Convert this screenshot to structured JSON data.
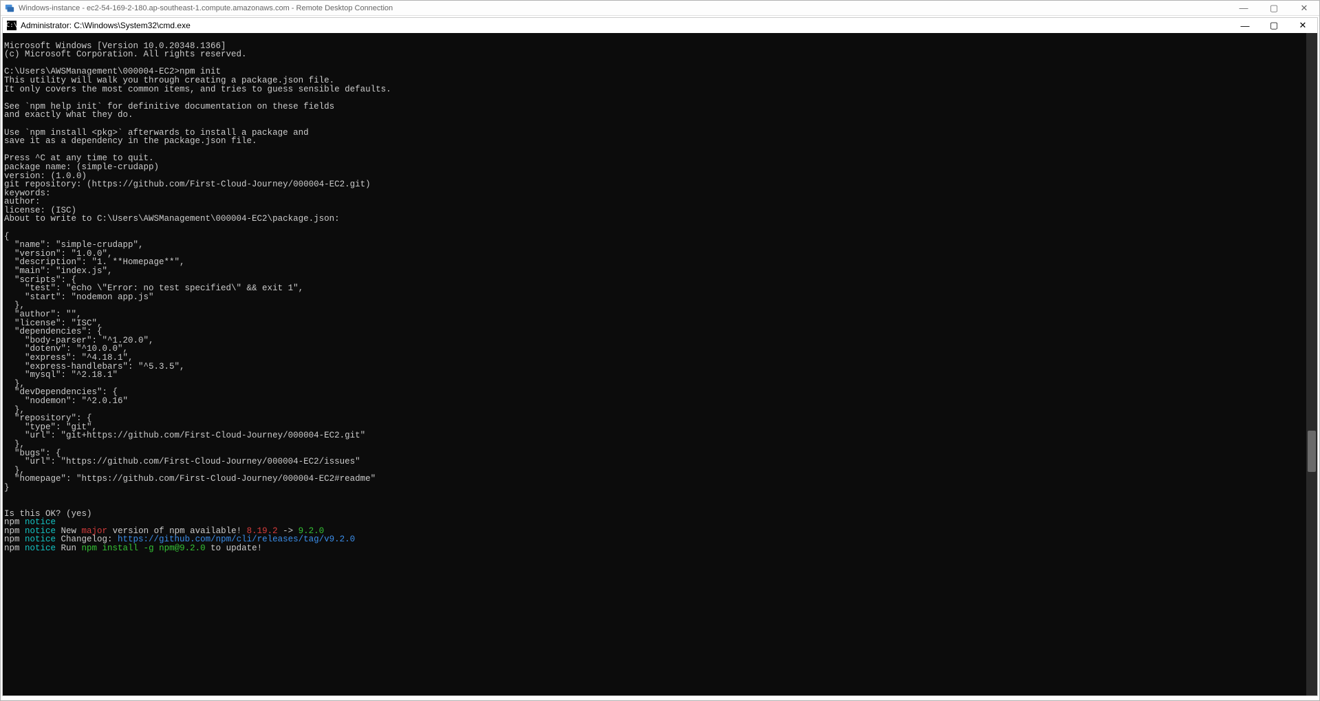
{
  "rdp": {
    "title": "Windows-instance - ec2-54-169-2-180.ap-southeast-1.compute.amazonaws.com - Remote Desktop Connection"
  },
  "cmd": {
    "title": "Administrator: C:\\Windows\\System32\\cmd.exe"
  },
  "terminal": {
    "header1": "Microsoft Windows [Version 10.0.20348.1366]",
    "header2": "(c) Microsoft Corporation. All rights reserved.",
    "prompt_cmd": "C:\\Users\\AWSManagement\\000004-EC2>npm init",
    "init1": "This utility will walk you through creating a package.json file.",
    "init2": "It only covers the most common items, and tries to guess sensible defaults.",
    "init3": "See `npm help init` for definitive documentation on these fields",
    "init4": "and exactly what they do.",
    "init5": "Use `npm install <pkg>` afterwards to install a package and",
    "init6": "save it as a dependency in the package.json file.",
    "init7": "Press ^C at any time to quit.",
    "q_pkg": "package name: (simple-crudapp)",
    "q_ver": "version: (1.0.0)",
    "q_git": "git repository: (https://github.com/First-Cloud-Journey/000004-EC2.git)",
    "q_keywords": "keywords:",
    "q_author": "author:",
    "q_license": "license: (ISC)",
    "about": "About to write to C:\\Users\\AWSManagement\\000004-EC2\\package.json:",
    "pkgjson": {
      "l00": "{",
      "l01": "  \"name\": \"simple-crudapp\",",
      "l02": "  \"version\": \"1.0.0\",",
      "l03": "  \"description\": \"1. **Homepage**\",",
      "l04": "  \"main\": \"index.js\",",
      "l05": "  \"scripts\": {",
      "l06": "    \"test\": \"echo \\\"Error: no test specified\\\" && exit 1\",",
      "l07": "    \"start\": \"nodemon app.js\"",
      "l08": "  },",
      "l09": "  \"author\": \"\",",
      "l10": "  \"license\": \"ISC\",",
      "l11": "  \"dependencies\": {",
      "l12": "    \"body-parser\": \"^1.20.0\",",
      "l13": "    \"dotenv\": \"^10.0.0\",",
      "l14": "    \"express\": \"^4.18.1\",",
      "l15": "    \"express-handlebars\": \"^5.3.5\",",
      "l16": "    \"mysql\": \"^2.18.1\"",
      "l17": "  },",
      "l18": "  \"devDependencies\": {",
      "l19": "    \"nodemon\": \"^2.0.16\"",
      "l20": "  },",
      "l21": "  \"repository\": {",
      "l22": "    \"type\": \"git\",",
      "l23": "    \"url\": \"git+https://github.com/First-Cloud-Journey/000004-EC2.git\"",
      "l24": "  },",
      "l25": "  \"bugs\": {",
      "l26": "    \"url\": \"https://github.com/First-Cloud-Journey/000004-EC2/issues\"",
      "l27": "  },",
      "l28": "  \"homepage\": \"https://github.com/First-Cloud-Journey/000004-EC2#readme\"",
      "l29": "}"
    },
    "isok": "Is this OK? (yes)",
    "npm_prefix": "npm ",
    "notice": "notice",
    "notice2a": " New ",
    "major": "major",
    "notice2b": " version of npm available! ",
    "old_ver": "8.19.2",
    "arrow": " -> ",
    "new_ver": "9.2.0",
    "changelog_a": " Changelog: ",
    "changelog_url": "https://github.com/npm/cli/releases/tag/v9.2.0",
    "run_a": " Run ",
    "install_cmd": "npm install -g npm@9.2.0",
    "run_b": " to update!"
  },
  "window_controls": {
    "minimize": "—",
    "maximize": "▢",
    "close": "✕"
  }
}
